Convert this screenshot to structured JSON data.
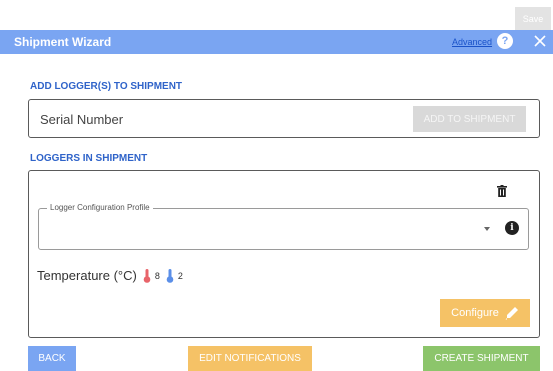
{
  "toolbar": {
    "save_label": "Save"
  },
  "header": {
    "title": "Shipment Wizard",
    "advanced_link": "Advanced",
    "help_symbol": "?",
    "color": "#7aa5f2"
  },
  "add_section": {
    "label": "ADD LOGGER(S) TO SHIPMENT",
    "serial_placeholder": "Serial Number",
    "serial_value": "",
    "add_button_label": "ADD TO SHIPMENT"
  },
  "loggers_section": {
    "label": "LOGGERS IN SHIPMENT",
    "profile_label": "Logger Configuration Profile",
    "profile_value": "",
    "temperature_label": "Temperature (°C)",
    "hot_count": "8",
    "cold_count": "2",
    "configure_label": "Configure"
  },
  "footer": {
    "back_label": "BACK",
    "notifications_label": "EDIT NOTIFICATIONS",
    "create_label": "CREATE SHIPMENT"
  },
  "icons": {
    "help": "question-circle-icon",
    "close": "close-icon",
    "trash": "trash-icon",
    "info": "info-circle-icon",
    "hot": "thermometer-hot-icon",
    "cold": "thermometer-cold-icon",
    "edit": "pencil-icon"
  },
  "colors": {
    "primary": "#7aa5f2",
    "warning": "#f5c266",
    "success": "#8cc56b",
    "label_blue": "#2f63c9",
    "hot": "#e8646a",
    "cold": "#5b8fe8"
  }
}
